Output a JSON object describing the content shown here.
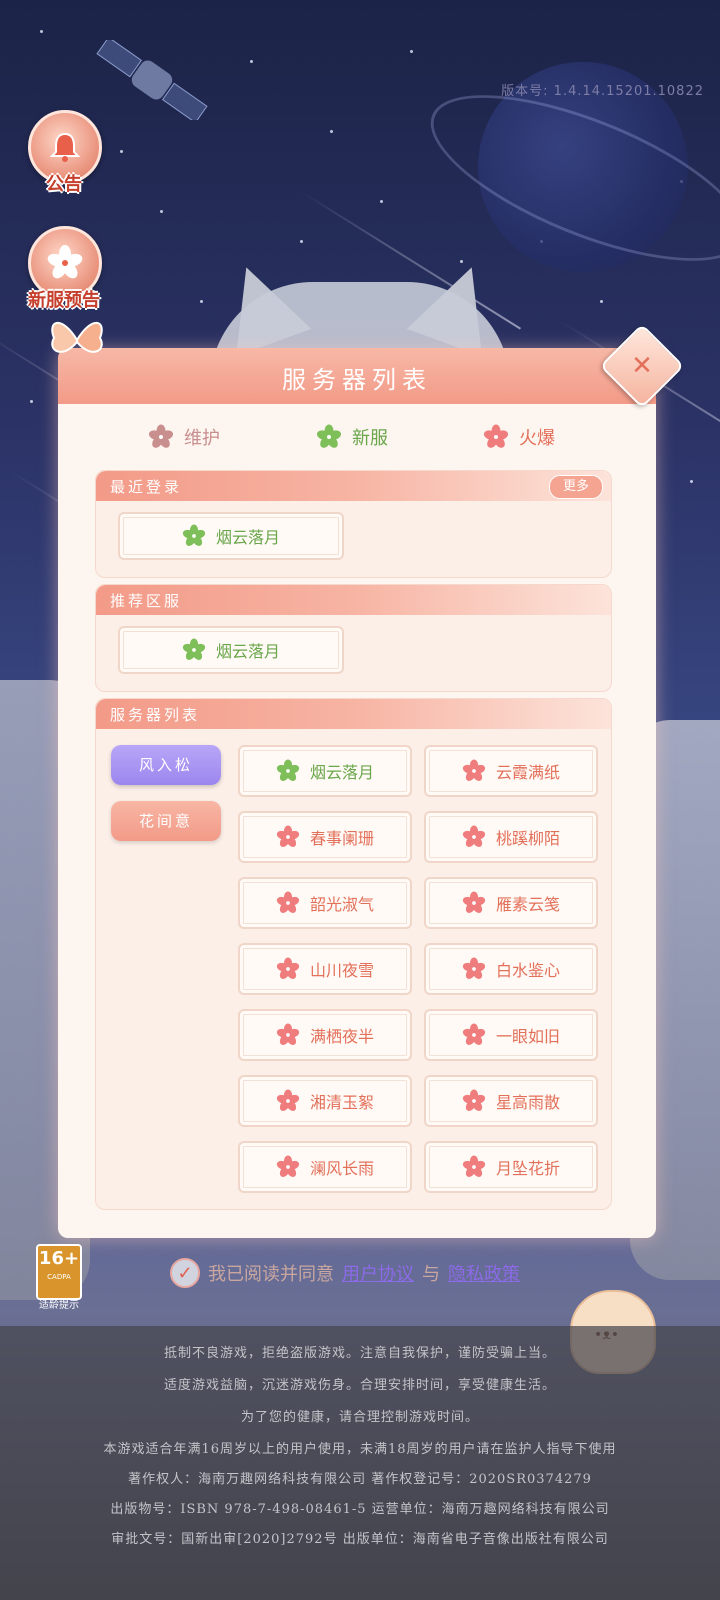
{
  "version": "版本号: 1.4.14.15201.10822",
  "side_buttons": [
    {
      "label": "公告"
    },
    {
      "label": "新服预告"
    }
  ],
  "panel": {
    "title": "服务器列表",
    "legend": [
      {
        "label": "维护",
        "color": "#c98e8e"
      },
      {
        "label": "新服",
        "color": "#7fbf5a"
      },
      {
        "label": "火爆",
        "color": "#ef7d7d"
      }
    ],
    "recent": {
      "title": "最近登录",
      "more_label": "更多",
      "servers": [
        {
          "name": "烟云落月",
          "status": "新服"
        }
      ]
    },
    "recommended": {
      "title": "推荐区服",
      "servers": [
        {
          "name": "烟云落月",
          "status": "新服"
        }
      ]
    },
    "server_list": {
      "title": "服务器列表",
      "tabs": [
        {
          "label": "风入松",
          "active": true
        },
        {
          "label": "花间意",
          "active": false
        }
      ],
      "servers": [
        {
          "name": "烟云落月",
          "status": "新服"
        },
        {
          "name": "云霞满纸",
          "status": "火爆"
        },
        {
          "name": "春事阑珊",
          "status": "火爆"
        },
        {
          "name": "桃蹊柳陌",
          "status": "火爆"
        },
        {
          "name": "韶光淑气",
          "status": "火爆"
        },
        {
          "name": "雁素云笺",
          "status": "火爆"
        },
        {
          "name": "山川夜雪",
          "status": "火爆"
        },
        {
          "name": "白水鉴心",
          "status": "火爆"
        },
        {
          "name": "满栖夜半",
          "status": "火爆"
        },
        {
          "name": "一眼如旧",
          "status": "火爆"
        },
        {
          "name": "湘清玉絮",
          "status": "火爆"
        },
        {
          "name": "星高雨散",
          "status": "火爆"
        },
        {
          "name": "澜风长雨",
          "status": "火爆"
        },
        {
          "name": "月坠花折",
          "status": "火爆"
        }
      ]
    }
  },
  "age_rating": {
    "number": "16+",
    "org": "CADPA",
    "label": "适龄提示"
  },
  "agreement": {
    "prefix": "我已阅读并同意",
    "user_agreement": "用户协议",
    "conjunction": "与",
    "privacy_policy": "隐私政策"
  },
  "footer": {
    "lines": [
      "抵制不良游戏，拒绝盗版游戏。注意自我保护，谨防受骗上当。",
      "适度游戏益脑，沉迷游戏伤身。合理安排时间，享受健康生活。",
      "为了您的健康，请合理控制游戏时间。",
      "本游戏适合年满16周岁以上的用户使用，未满18周岁的用户请在监护人指导下使用",
      "著作权人：海南万趣网络科技有限公司 著作权登记号：2020SR0374279",
      "出版物号：ISBN 978-7-498-08461-5 运营单位：海南万趣网络科技有限公司",
      "审批文号：国新出审[2020]2792号 出版单位：海南省电子音像出版社有限公司"
    ]
  }
}
